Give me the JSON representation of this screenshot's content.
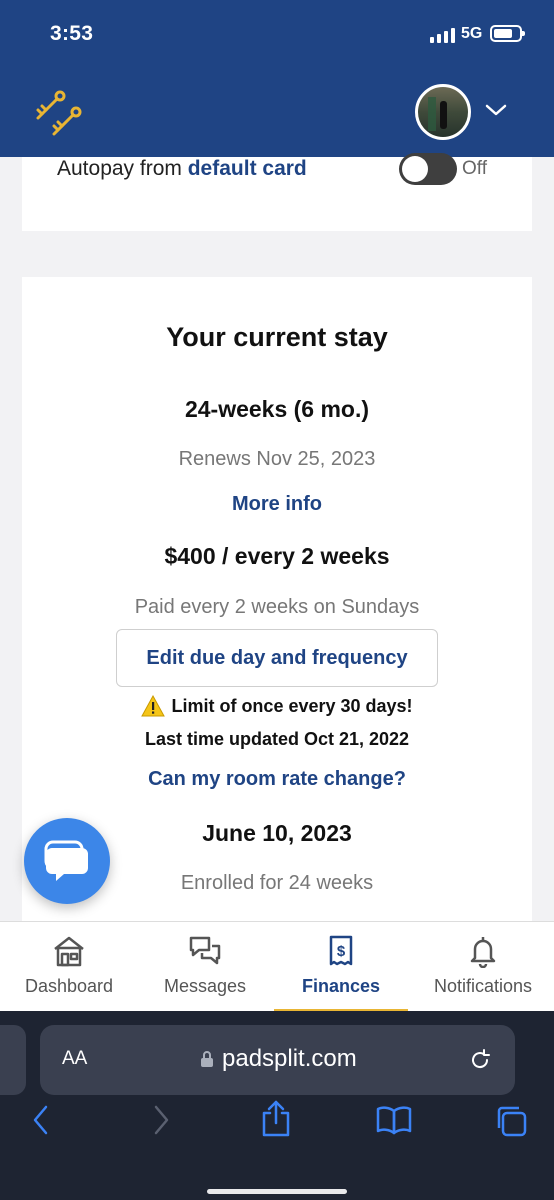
{
  "status_bar": {
    "time": "3:53",
    "network": "5G",
    "signal_bars": 4,
    "battery_level": 0.75
  },
  "header": {
    "logo_icon": "keys-icon",
    "avatar_icon": "user-avatar",
    "menu_icon": "chevron-down-icon"
  },
  "autopay": {
    "label": "Autopay from ",
    "link": "default card",
    "toggle_state": "Off"
  },
  "stay": {
    "title": "Your current stay",
    "plan": "24-weeks (6 mo.)",
    "renews": "Renews Nov 25, 2023",
    "more_info": "More info",
    "price": "$400 / every 2 weeks",
    "schedule": "Paid every 2 weeks on Sundays",
    "edit_button": "Edit due day and frequency",
    "limit_warning": "Limit of once every 30 days!",
    "last_updated": "Last time updated Oct 21, 2022",
    "rate_link": "Can my room rate change?",
    "start_date": "June 10, 2023",
    "enrolled": "Enrolled for 24 weeks"
  },
  "tabs": [
    {
      "label": "Dashboard",
      "icon": "house-icon",
      "active": false
    },
    {
      "label": "Messages",
      "icon": "chat-bubbles-icon",
      "active": false
    },
    {
      "label": "Finances",
      "icon": "receipt-dollar-icon",
      "active": true
    },
    {
      "label": "Notifications",
      "icon": "bell-icon",
      "active": false
    }
  ],
  "browser": {
    "text_size_label": "AA",
    "url": "padsplit.com"
  },
  "colors": {
    "brand_navy": "#1f4484",
    "accent_gold": "#e8b534",
    "chat_blue": "#3c86e8",
    "safari_bg": "#1e2432",
    "safari_icon_blue": "#3b82f6"
  }
}
